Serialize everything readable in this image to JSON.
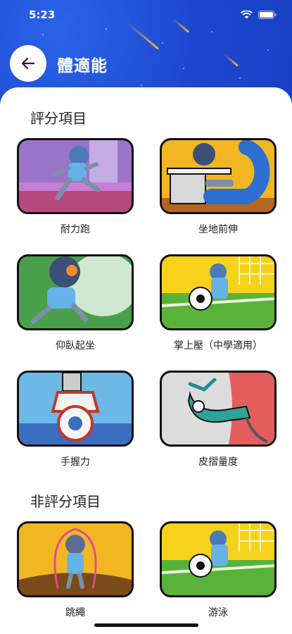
{
  "status_bar": {
    "time": "5:23"
  },
  "header": {
    "title": "體適能"
  },
  "sections": [
    {
      "title": "評分項目"
    },
    {
      "title": "非評分項目"
    }
  ],
  "items": [
    {
      "label": "耐力跑",
      "icon": "running-illustration",
      "bg": "#9b73c9"
    },
    {
      "label": "坐地前伸",
      "icon": "sit-and-reach-illustration",
      "bg": "#f2b623"
    },
    {
      "label": "仰臥起坐",
      "icon": "sit-up-illustration",
      "bg": "#4aa04a"
    },
    {
      "label": "掌上壓（中學適用）",
      "icon": "soccer-illustration",
      "bg": "#f7d21b"
    },
    {
      "label": "手握力",
      "icon": "hand-grip-illustration",
      "bg": "#6cb8e6"
    },
    {
      "label": "皮摺量度",
      "icon": "skinfold-caliper-illustration",
      "bg": "#e45d5d"
    },
    {
      "label": "跳繩",
      "icon": "jump-rope-illustration",
      "bg": "#f2b623"
    },
    {
      "label": "游泳",
      "icon": "soccer-illustration",
      "bg": "#f7d21b"
    }
  ]
}
